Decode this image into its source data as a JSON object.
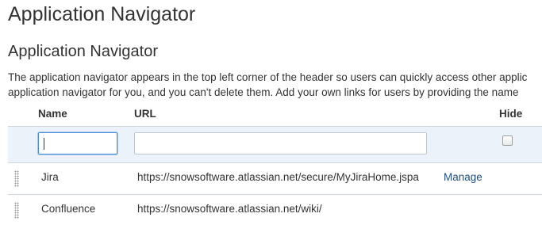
{
  "page": {
    "title": "Application Navigator"
  },
  "section": {
    "title": "Application Navigator",
    "description_line1": "The application navigator appears in the top left corner of the header so users can quickly access other applic",
    "description_line2": "application navigator for you, and you can't delete them. Add your own links for users by providing the name"
  },
  "table": {
    "headers": {
      "name": "Name",
      "url": "URL",
      "hide": "Hide"
    },
    "new_entry": {
      "name_value": "",
      "url_value": "",
      "hide_checked": false
    },
    "rows": [
      {
        "name": "Jira",
        "url": "https://snowsoftware.atlassian.net/secure/MyJiraHome.jspa",
        "action": "Manage"
      },
      {
        "name": "Confluence",
        "url": "https://snowsoftware.atlassian.net/wiki/",
        "action": ""
      }
    ]
  },
  "colors": {
    "link": "#205081",
    "add_row_background": "#ebf2f9",
    "focus_border": "#4a90d9"
  }
}
